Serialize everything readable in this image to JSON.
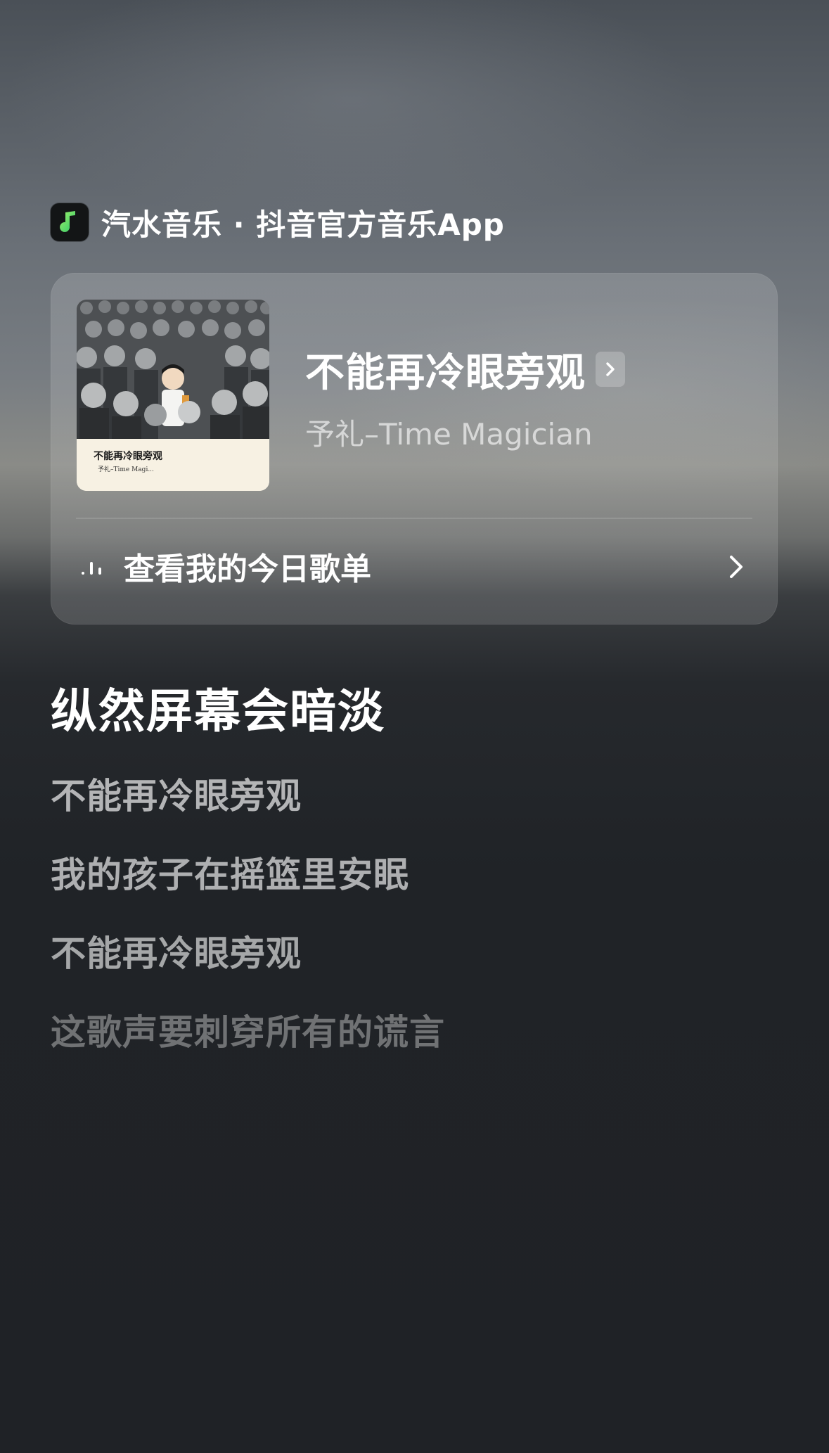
{
  "brand": {
    "logo_icon": "qishui-music-logo-icon",
    "text": "汽水音乐 · 抖音官方音乐App",
    "logo_color": "#37d36b"
  },
  "song_card": {
    "cover": {
      "title": "不能再冷眼旁观",
      "subtitle": "予礼–Time Magi..."
    },
    "title": "不能再冷眼旁观",
    "title_icon": "chevron-right-icon",
    "artist": "予礼–Time Magician",
    "playlist": {
      "icon": "audio-bars-icon",
      "label": "查看我的今日歌单",
      "chevron_icon": "chevron-right-icon"
    }
  },
  "lyrics": {
    "current": "纵然屏幕会暗淡",
    "lines": [
      "不能再冷眼旁观",
      "我的孩子在摇篮里安眠",
      "不能再冷眼旁观",
      "这歌声要刺穿所有的谎言"
    ]
  }
}
